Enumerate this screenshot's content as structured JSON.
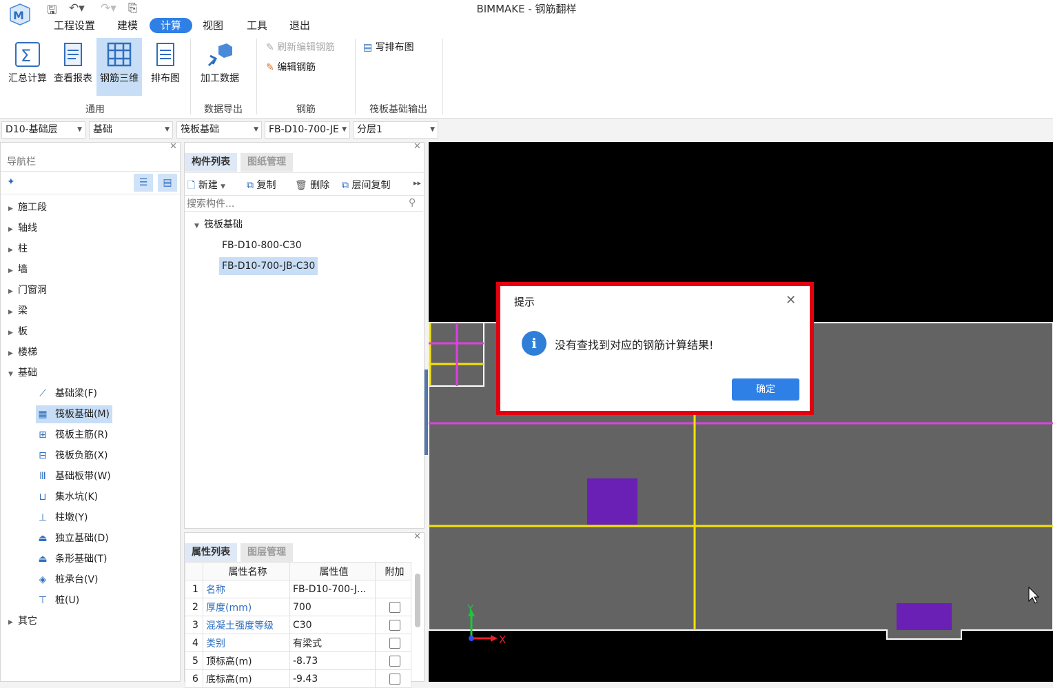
{
  "app": {
    "title": "BIMMAKE - 钢筋翻样"
  },
  "menu": {
    "tabs": [
      "工程设置",
      "建模",
      "计算",
      "视图",
      "工具",
      "退出"
    ],
    "active": "计算"
  },
  "ribbon": {
    "general": {
      "label": "通用",
      "buttons": [
        "汇总计算",
        "查看报表",
        "钢筋三维",
        "排布图"
      ]
    },
    "export": {
      "label": "数据导出",
      "buttons": [
        "加工数据"
      ]
    },
    "rebar": {
      "label": "钢筋",
      "buttons": [
        "刷新编辑钢筋",
        "编辑钢筋"
      ]
    },
    "raft_output": {
      "label": "筏板基础输出",
      "buttons": [
        "写排布图"
      ]
    }
  },
  "selectors": [
    "D10-基础层",
    "基础",
    "筏板基础",
    "FB-D10-700-JE",
    "分层1"
  ],
  "nav": {
    "title": "导航栏",
    "items": [
      "施工段",
      "轴线",
      "柱",
      "墙",
      "门窗洞",
      "梁",
      "板",
      "楼梯",
      "基础"
    ],
    "foundation_children": [
      "基础梁(F)",
      "筏板基础(M)",
      "筏板主筋(R)",
      "筏板负筋(X)",
      "基础板带(W)",
      "集水坑(K)",
      "柱墩(Y)",
      "独立基础(D)",
      "条形基础(T)",
      "桩承台(V)",
      "桩(U)"
    ],
    "other": "其它",
    "selected_child": "筏板基础(M)"
  },
  "components": {
    "tabs": [
      "构件列表",
      "图纸管理"
    ],
    "toolbar": [
      "新建",
      "复制",
      "删除",
      "层间复制"
    ],
    "search_placeholder": "搜索构件...",
    "group": "筏板基础",
    "items": [
      "FB-D10-800-C30",
      "FB-D10-700-JB-C30"
    ],
    "selected": "FB-D10-700-JB-C30"
  },
  "properties": {
    "tabs": [
      "属性列表",
      "图层管理"
    ],
    "headers": [
      "属性名称",
      "属性值",
      "附加"
    ],
    "rows": [
      {
        "n": "1",
        "name": "名称",
        "value": "FB-D10-700-J..."
      },
      {
        "n": "2",
        "name": "厚度(mm)",
        "value": "700"
      },
      {
        "n": "3",
        "name": "混凝土强度等级",
        "value": "C30"
      },
      {
        "n": "4",
        "name": "类别",
        "value": "有梁式"
      },
      {
        "n": "5",
        "name": "顶标高(m)",
        "value": "-8.73"
      },
      {
        "n": "6",
        "name": "底标高(m)",
        "value": "-9.43"
      }
    ]
  },
  "dialog": {
    "title": "提示",
    "message": "没有查找到对应的钢筋计算结果!",
    "ok": "确定"
  },
  "axes": {
    "x": "X",
    "y": "Y"
  },
  "colors": {
    "accent": "#2f80e6",
    "highlight": "#e3000f",
    "viewport_bg": "#000000",
    "slab": "#636363",
    "grid_yellow": "#f5e400",
    "grid_magenta": "#e040e0",
    "column_purple": "#6a1fb5"
  }
}
